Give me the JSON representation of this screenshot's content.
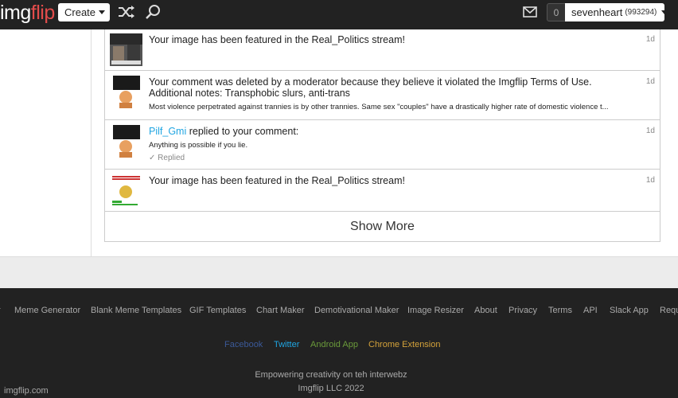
{
  "header": {
    "logo_img": "img",
    "logo_flip": "flip",
    "create_label": "Create",
    "notif_count": "0",
    "username": "sevenheart",
    "user_points": "(993294)"
  },
  "notifications": [
    {
      "text": "Your image has been featured in the Real_Politics stream!",
      "time": "1d"
    },
    {
      "text": "Your comment was deleted by a moderator because they believe it violated the Imgflip Terms of Use. Additional notes: Transphobic slurs, anti-trans",
      "sub": "Most violence perpetrated against trannies is by other trannies. Same sex \"couples\" have a drastically higher rate of domestic violence t...",
      "time": "1d"
    },
    {
      "user": "Pilf_Gmi",
      "text": " replied to your comment:",
      "sub": "Anything is possible if you lie.",
      "status": "Replied",
      "time": "1d"
    },
    {
      "text": "Your image has been featured in the Real_Politics stream!",
      "time": "1d"
    }
  ],
  "show_more": "Show More",
  "footer": {
    "links": [
      "r",
      "Meme Generator",
      "Blank Meme Templates",
      "GIF Templates",
      "Chart Maker",
      "Demotivational Maker",
      "Image Resizer",
      "About",
      "Privacy",
      "Terms",
      "API",
      "Slack App",
      "Requ"
    ],
    "social": {
      "facebook": "Facebook",
      "twitter": "Twitter",
      "android": "Android App",
      "chrome": "Chrome Extension"
    },
    "tagline": "Empowering creativity on teh interwebz",
    "copyright": "Imgflip LLC 2022",
    "domain": "imgflip.com"
  },
  "colors": {
    "header_bg": "#222222",
    "logo_red": "#e24c4b",
    "link_blue": "#1fa5e2",
    "facebook": "#3b5998",
    "twitter": "#1fa5e2",
    "android": "#6a9a3a",
    "chrome": "#d4a23a"
  }
}
